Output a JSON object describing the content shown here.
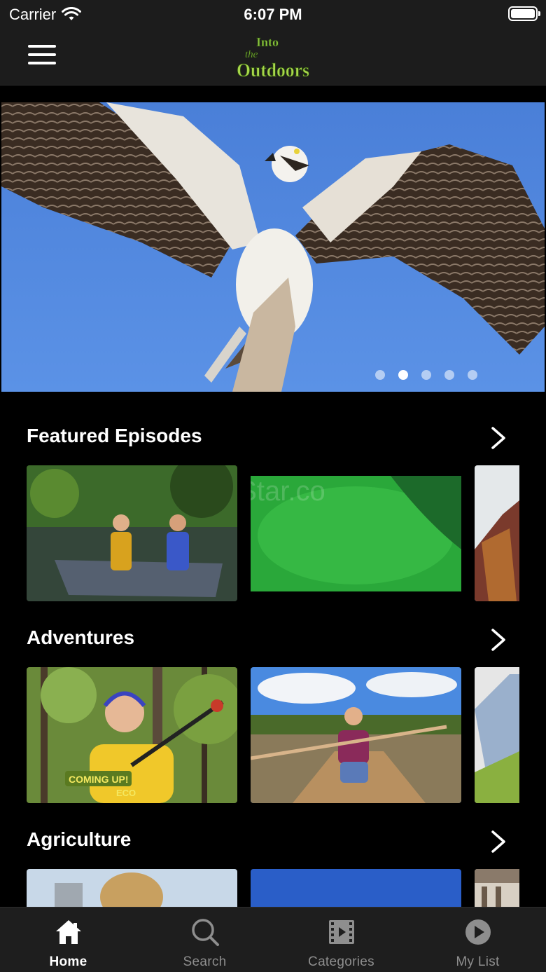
{
  "status": {
    "carrier": "Carrier",
    "time": "6:07 PM"
  },
  "header": {
    "logo_text": [
      "Into",
      "the",
      "Outdoors"
    ],
    "menu_icon": "hamburger-icon"
  },
  "hero": {
    "slide_count": 5,
    "active_slide": 2
  },
  "sections": [
    {
      "title": "Featured Episodes",
      "watermark": "eStar.co"
    },
    {
      "title": "Adventures",
      "badge": "COMING UP!",
      "badge_sub": "ECO"
    },
    {
      "title": "Agriculture"
    }
  ],
  "tabs": [
    {
      "label": "Home",
      "icon": "home-icon",
      "active": true
    },
    {
      "label": "Search",
      "icon": "search-icon",
      "active": false
    },
    {
      "label": "Categories",
      "icon": "film-icon",
      "active": false
    },
    {
      "label": "My List",
      "icon": "play-circle-icon",
      "active": false
    }
  ],
  "colors": {
    "accent_green": "#8cc63f",
    "sky_blue": "#4f86de",
    "tab_inactive": "#8e8e8e"
  }
}
